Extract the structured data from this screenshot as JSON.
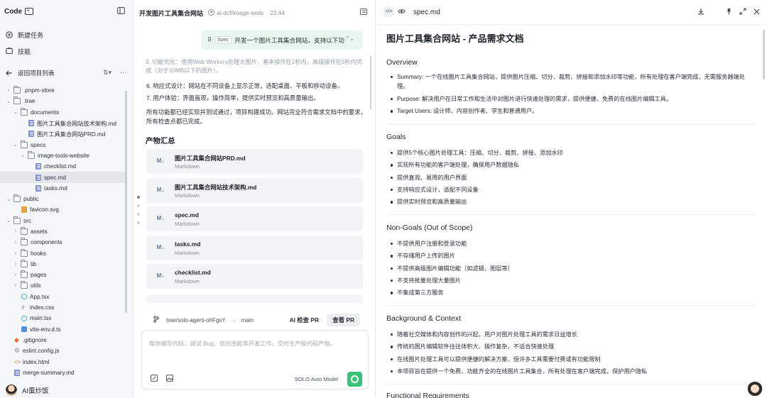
{
  "app": {
    "brand": "Code",
    "nav": [
      {
        "label": "新建任务",
        "icon": "new-task-icon"
      },
      {
        "label": "技能",
        "icon": "skills-icon"
      }
    ],
    "back_label": "返回项目列表",
    "user_name": "AI蛋炒饭"
  },
  "file_tree": [
    {
      "label": ".pnpm-store",
      "type": "folder",
      "depth": 0,
      "expanded": false
    },
    {
      "label": ".trae",
      "type": "folder",
      "depth": 0,
      "expanded": true
    },
    {
      "label": "documents",
      "type": "folder",
      "depth": 1,
      "expanded": true
    },
    {
      "label": "图片工具集合网站技术架构.md",
      "type": "md",
      "depth": 2
    },
    {
      "label": "图片工具集合网站PRD.md",
      "type": "md",
      "depth": 2
    },
    {
      "label": "specs",
      "type": "folder",
      "depth": 1,
      "expanded": true
    },
    {
      "label": "image-tools-website",
      "type": "folder",
      "depth": 2,
      "expanded": true
    },
    {
      "label": "checklist.md",
      "type": "md",
      "depth": 3
    },
    {
      "label": "spec.md",
      "type": "md",
      "depth": 3,
      "selected": true
    },
    {
      "label": "tasks.md",
      "type": "md",
      "depth": 3
    },
    {
      "label": "public",
      "type": "folder",
      "depth": 0,
      "expanded": true
    },
    {
      "label": "favicon.svg",
      "type": "svg",
      "depth": 1
    },
    {
      "label": "src",
      "type": "folder",
      "depth": 0,
      "expanded": true
    },
    {
      "label": "assets",
      "type": "folder",
      "depth": 1,
      "expanded": false
    },
    {
      "label": "components",
      "type": "folder",
      "depth": 1,
      "expanded": false
    },
    {
      "label": "hooks",
      "type": "folder",
      "depth": 1,
      "expanded": false
    },
    {
      "label": "lib",
      "type": "folder",
      "depth": 1,
      "expanded": false
    },
    {
      "label": "pages",
      "type": "folder",
      "depth": 1,
      "expanded": false
    },
    {
      "label": "utils",
      "type": "folder",
      "depth": 1,
      "expanded": false
    },
    {
      "label": "App.tsx",
      "type": "react",
      "depth": 1
    },
    {
      "label": "index.css",
      "type": "css",
      "depth": 1
    },
    {
      "label": "main.tsx",
      "type": "react",
      "depth": 1
    },
    {
      "label": "vite-env.d.ts",
      "type": "ts",
      "depth": 1
    },
    {
      "label": ".gitignore",
      "type": "git",
      "depth": 0
    },
    {
      "label": "eslint.config.js",
      "type": "gear",
      "depth": 0
    },
    {
      "label": "index.html",
      "type": "html",
      "depth": 0
    },
    {
      "label": "merge-summary.md",
      "type": "md",
      "depth": 0
    }
  ],
  "chat": {
    "title": "开发图片工具集合网站",
    "repo": "ai-dcf/image-tools",
    "time": "22:44",
    "spec_tag": "Spec",
    "spec_text": "开发一个图片工具集合网站，支持以下功",
    "faded_text": "3. 切能优化：使用Web Workers处理大图片，基本操作在1秒内，高级操作在5秒内完成（对于10MB以下的图片）。",
    "lines": [
      "6. 响应式设计：网站在不同设备上显示正常，适配桌面、平板和移动设备。",
      "7. 用户体验：界面直观，操作简单，提供实时预览和高质量输出。",
      "所有功能都已经实现并测试通过，项目构建成功。网站完全符合需求文档中的要求，",
      "所有检查点都已完成。"
    ],
    "artifacts_heading": "产物汇总",
    "artifacts": [
      {
        "name": "图片工具集合网站PRD.md",
        "type": "Markdown"
      },
      {
        "name": "图片工具集合网站技术架构.md",
        "type": "Markdown"
      },
      {
        "name": "spec.md",
        "type": "Markdown"
      },
      {
        "name": "tasks.md",
        "type": "Markdown"
      },
      {
        "name": "checklist.md",
        "type": "Markdown"
      }
    ],
    "branch": "trae/solo-agent-ohFgsY",
    "base_branch": "main",
    "pr_check": "AI 检查 PR",
    "pr_view": "查看 PR",
    "composer_placeholder": "帮你编写代码、调试 Bug、优化性能等开发工作，交付生产级代码产物。",
    "model": "SOLO Auto Model"
  },
  "doc": {
    "file_name": "spec.md",
    "title": "图片工具集合网站 - 产品需求文档",
    "overview_h": "Overview",
    "overview": [
      {
        "key": "Summary",
        "text": ": 一个在线图片工具集合网站，提供图片压缩、切分、裁剪、拼接和添加水印等功能，所有处理在客户端完成，无需服务器端处理。"
      },
      {
        "key": "Purpose",
        "text": ": 解决用户在日常工作和生活中对图片进行快速处理的需求，提供便捷、免费的在线图片编辑工具。"
      },
      {
        "key": "Target Users",
        "text": ": 设计师、内容创作者、学生和普通用户。"
      }
    ],
    "goals_h": "Goals",
    "goals": [
      "提供5个核心图片处理工具：压缩、切分、裁剪、拼接、添加水印",
      "实现所有功能的客户端处理，确保用户数据隐私",
      "提供直观、易用的用户界面",
      "支持响应式设计，适配不同设备",
      "提供实时预览和高质量输出"
    ],
    "nongoals_h": "Non-Goals (Out of Scope)",
    "nongoals": [
      "不提供用户注册和登录功能",
      "不存储用户上传的图片",
      "不提供高级图片编辑功能（如滤镜、图层等）",
      "不支持批量处理大量图片",
      "不集成第三方服务"
    ],
    "background_h": "Background & Context",
    "background": [
      "随着社交媒体和内容创作的兴起，用户对图片处理工具的需求日益增长",
      "传统的图片编辑软件往往体积大、操作复杂，不适合快速处理",
      "在线图片处理工具可以提供便捷的解决方案，但许多工具需要付费或有功能限制",
      "本项目旨在提供一个免费、功能齐全的在线图片工具集合，所有处理在客户端完成，保护用户隐私"
    ],
    "functional_h": "Functional Requirements"
  }
}
